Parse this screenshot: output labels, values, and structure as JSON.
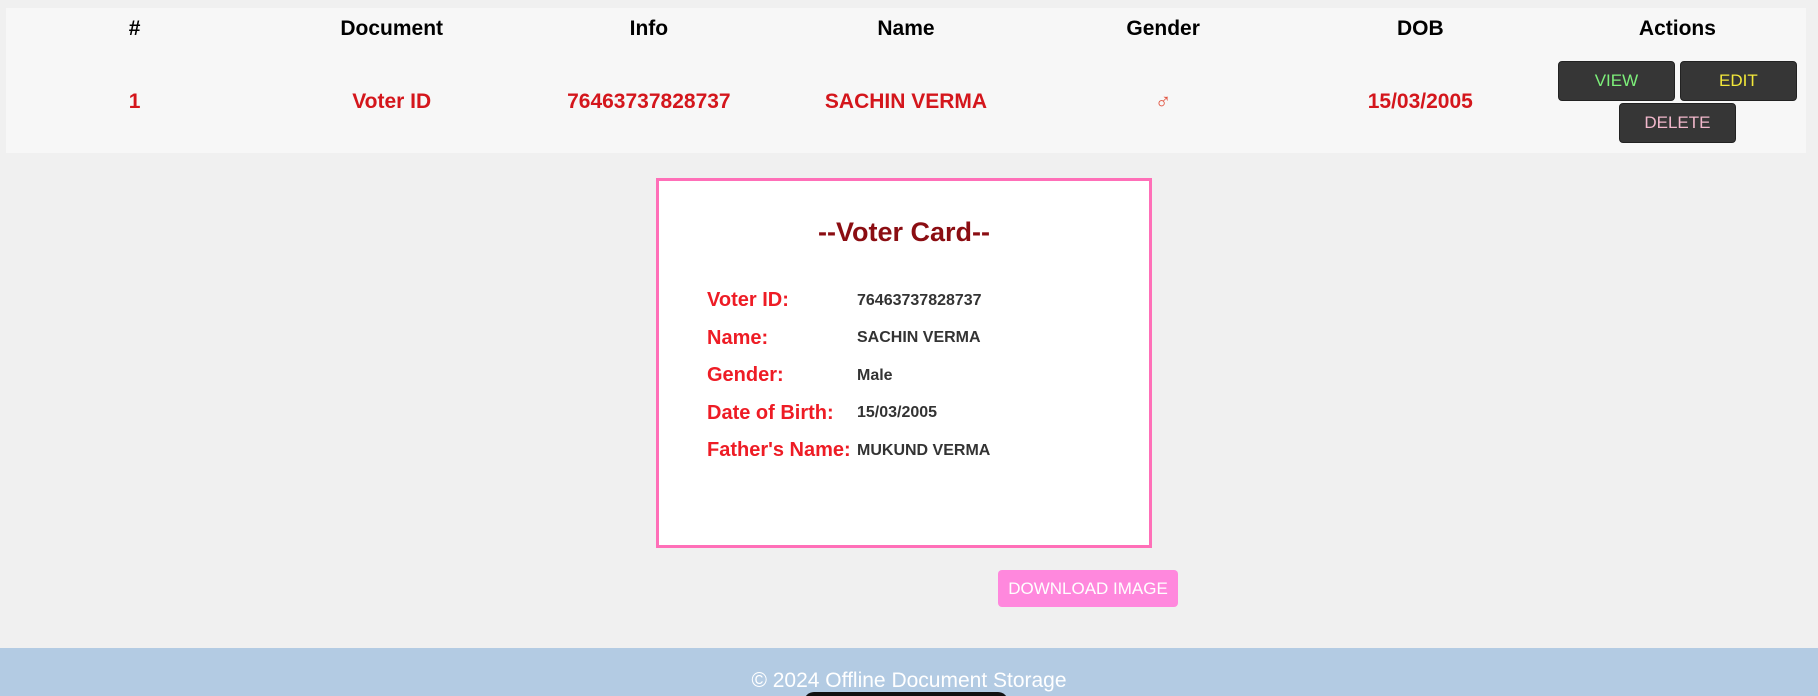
{
  "table": {
    "headers": [
      "#",
      "Document",
      "Info",
      "Name",
      "Gender",
      "DOB",
      "Actions"
    ],
    "rows": [
      {
        "index": "1",
        "document": "Voter ID",
        "info": "76463737828737",
        "name": "SACHIN VERMA",
        "gender": "♂",
        "dob": "15/03/2005",
        "actions": {
          "view": "VIEW",
          "edit": "EDIT",
          "delete": "DELETE"
        }
      }
    ]
  },
  "card": {
    "title": "--Voter Card--",
    "fields": [
      {
        "label": "Voter ID:",
        "value": "76463737828737"
      },
      {
        "label": "Name:",
        "value": "SACHIN VERMA"
      },
      {
        "label": "Gender:",
        "value": "Male"
      },
      {
        "label": "Date of Birth:",
        "value": "15/03/2005"
      },
      {
        "label": "Father's Name:",
        "value": "MUKUND VERMA"
      }
    ]
  },
  "download_button": "DOWNLOAD IMAGE",
  "footer": {
    "text": "© 2024 Offline Document Storage"
  },
  "colors": {
    "page_bg": "#f0f0f0",
    "table_bg": "#f7f7f7",
    "row_text": "#d4161c",
    "card_border": "#ff6fb8",
    "card_title": "#8b0d12",
    "card_label": "#ee1c25",
    "download_button": "#ff88dd",
    "footer_bg": "#b3cbe3",
    "view_text": "#7df07a",
    "edit_text": "#f3e83a",
    "delete_text": "#f2b8cc"
  }
}
